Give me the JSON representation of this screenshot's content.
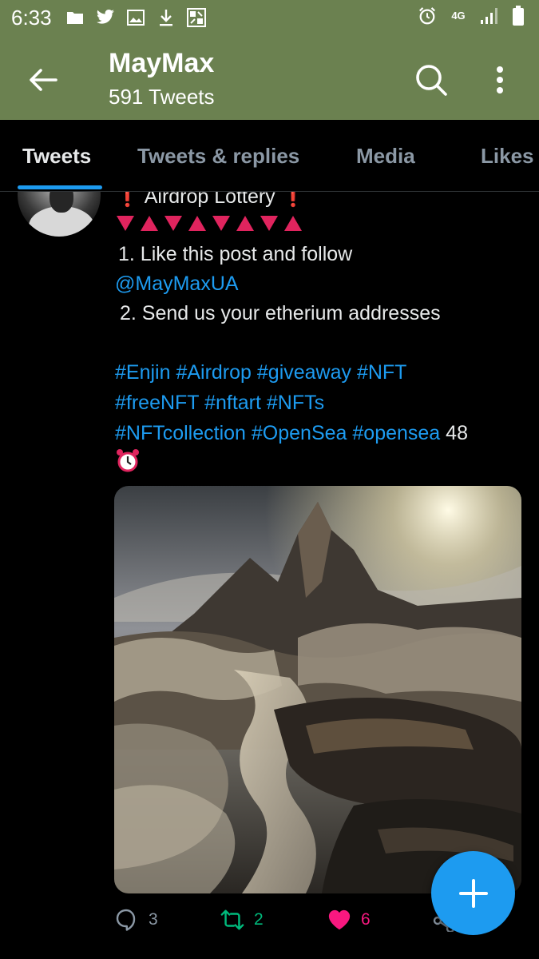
{
  "status_bar": {
    "time": "6:33",
    "network": "4G",
    "icons_left": [
      "folder-icon",
      "twitter-icon",
      "image-icon",
      "download-icon",
      "pattern-icon"
    ],
    "icons_right": [
      "alarm-icon",
      "lte-icon",
      "signal-icon",
      "battery-icon"
    ]
  },
  "header": {
    "title": "MayMax",
    "subtitle": "591 Tweets",
    "background": "#6b8150"
  },
  "tabs": [
    {
      "label": "Tweets",
      "active": true
    },
    {
      "label": "Tweets & replies",
      "active": false
    },
    {
      "label": "Media",
      "active": false
    },
    {
      "label": "Likes",
      "active": false
    }
  ],
  "tweet": {
    "title": "Airdrop Lottery",
    "step1": "1. Like this post and follow",
    "mention": "@MayMaxUA",
    "step2": "2. Send us your etherium addresses",
    "hashtags_line1": "#Enjin #Airdrop #giveaway #NFT",
    "hashtags_line2": "#freeNFT #nftart #NFTs",
    "hashtags_line3": "#NFTcollection #OpenSea #opensea",
    "count_after_tags": "48",
    "reply_count": "3",
    "retweet_count": "2",
    "like_count": "6"
  },
  "colors": {
    "accent": "#1d9bf0",
    "retweet": "#00ba7c",
    "like": "#f91880",
    "header_green": "#6b8150"
  }
}
